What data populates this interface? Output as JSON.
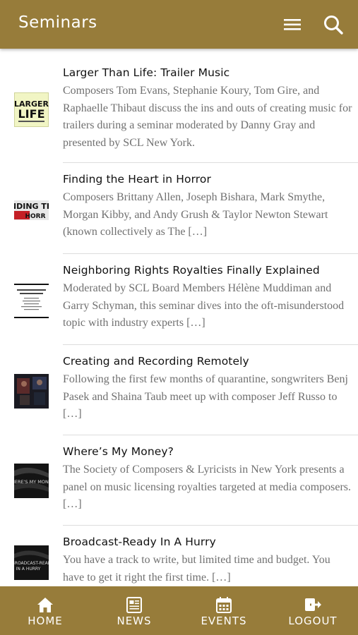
{
  "header": {
    "title": "Seminars",
    "menu_icon": "hamburger-menu-icon",
    "search_icon": "search-icon"
  },
  "colors": {
    "brand": "#977c3a",
    "title_text": "#111111",
    "excerpt_text": "#707070"
  },
  "seminars": [
    {
      "title": "Larger Than Life: Trailer Music",
      "excerpt": "Composers Tom Evans, Stephanie Koury, Tom Gire, and Raphaelle Thibaut discuss the ins and outs of creating music for trailers during a seminar moderated by Danny Gray and presented by SCL New York.",
      "thumb_text": "LARGER THAN LIFE"
    },
    {
      "title": "Finding the Heart in Horror",
      "excerpt": "Composers Brittany Allen, Joseph Bishara, Mark Smythe, Morgan Kibby, and Andy Grush & Taylor Newton Stewart (known collectively as The […]",
      "thumb_text": "NDING TH HORR"
    },
    {
      "title": "Neighboring Rights Royalties Finally Explained",
      "excerpt": "Moderated by SCL Board Members Hélène Muddiman and Garry Schyman, this seminar dives into the oft-misunderstood topic with industry experts […]",
      "thumb_text": "Neighboring Rights Royalties Finally Explained"
    },
    {
      "title": "Creating and Recording Remotely",
      "excerpt": "Following the first few months of quarantine, songwriters Benj Pasek and Shaina Taub meet up with composer Jeff Russo to […]",
      "thumb_text": ""
    },
    {
      "title": "Where’s My Money?",
      "excerpt": "The Society of Composers & Lyricists in New York presents a panel on music licensing royalties targeted at media composers. […]",
      "thumb_text": "HERE'S MY MONE"
    },
    {
      "title": "Broadcast-Ready In A Hurry",
      "excerpt": "You have a track to write, but limited time and budget. You have to get it right the first time. […]",
      "thumb_text": "BROADCAST-READ IN A HURRY"
    }
  ],
  "bottom_nav": [
    {
      "label": "HOME",
      "icon": "home-icon"
    },
    {
      "label": "NEWS",
      "icon": "newspaper-icon"
    },
    {
      "label": "EVENTS",
      "icon": "calendar-icon"
    },
    {
      "label": "LOGOUT",
      "icon": "logout-icon"
    }
  ]
}
